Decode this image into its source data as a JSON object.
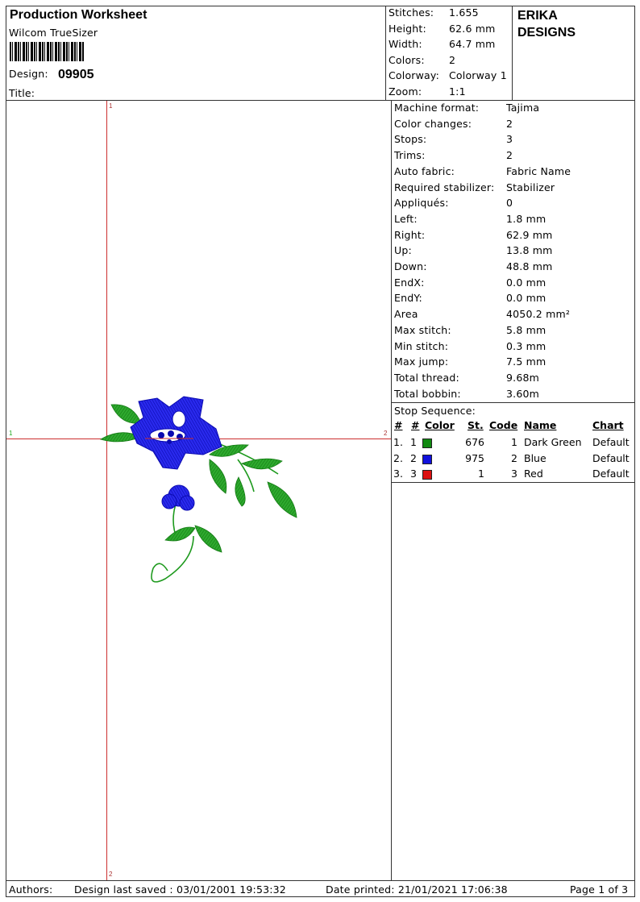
{
  "header": {
    "title": "Production Worksheet",
    "subtitle": "Wilcom TrueSizer",
    "design_label": "Design:",
    "design_number": "09905",
    "title_label": "Title:",
    "company_line1": "ERIKA",
    "company_line2": "DESIGNS"
  },
  "summary": [
    {
      "label": "Stitches:",
      "value": "1.655"
    },
    {
      "label": "Height:",
      "value": "62.6 mm"
    },
    {
      "label": "Width:",
      "value": "64.7 mm"
    },
    {
      "label": "Colors:",
      "value": "2"
    },
    {
      "label": "Colorway:",
      "value": "Colorway 1"
    },
    {
      "label": "Zoom:",
      "value": "1:1"
    }
  ],
  "details": [
    {
      "label": "Machine format:",
      "value": "Tajima"
    },
    {
      "label": "Color changes:",
      "value": "2"
    },
    {
      "label": "Stops:",
      "value": "3"
    },
    {
      "label": "Trims:",
      "value": "2"
    },
    {
      "label": "Auto fabric:",
      "value": "Fabric Name"
    },
    {
      "label": "Required stabilizer:",
      "value": "Stabilizer"
    },
    {
      "label": "Appliqués:",
      "value": "0"
    },
    {
      "label": "Left:",
      "value": "1.8 mm"
    },
    {
      "label": "Right:",
      "value": "62.9 mm"
    },
    {
      "label": "Up:",
      "value": "13.8 mm"
    },
    {
      "label": "Down:",
      "value": "48.8 mm"
    },
    {
      "label": "EndX:",
      "value": "0.0 mm"
    },
    {
      "label": "EndY:",
      "value": "0.0 mm"
    },
    {
      "label": "Area",
      "value": "4050.2 mm²"
    },
    {
      "label": "Max stitch:",
      "value": "5.8 mm"
    },
    {
      "label": "Min stitch:",
      "value": "0.3 mm"
    },
    {
      "label": "Max jump:",
      "value": "7.5 mm"
    },
    {
      "label": "Total thread:",
      "value": "9.68m"
    },
    {
      "label": "Total bobbin:",
      "value": "3.60m"
    }
  ],
  "stop_sequence": {
    "title": "Stop Sequence:",
    "headers": {
      "seq": "#",
      "num": "#",
      "color": "Color",
      "stitches": "St.",
      "code": "Code",
      "name": "Name",
      "chart": "Chart"
    },
    "rows": [
      {
        "seq": "1.",
        "num": "1",
        "color": "#118a11",
        "stitches": "676",
        "code": "1",
        "name": "Dark Green",
        "chart": "Default"
      },
      {
        "seq": "2.",
        "num": "2",
        "color": "#1111dd",
        "stitches": "975",
        "code": "2",
        "name": "Blue",
        "chart": "Default"
      },
      {
        "seq": "3.",
        "num": "3",
        "color": "#dd1111",
        "stitches": "1",
        "code": "3",
        "name": "Red",
        "chart": "Default"
      }
    ]
  },
  "canvas": {
    "axis_ticks": {
      "top": "1",
      "bottom": "2",
      "left": "1",
      "right": "2"
    },
    "thread_colors": {
      "leaf": "#1e9a1e",
      "flower": "#1414d8",
      "marker": "#cc2f2f"
    }
  },
  "footer": {
    "authors": "Authors:",
    "last_saved": "Design last saved : 03/01/2001 19:53:32",
    "printed": "Date printed: 21/01/2021 17:06:38",
    "page": "Page 1 of 3"
  }
}
